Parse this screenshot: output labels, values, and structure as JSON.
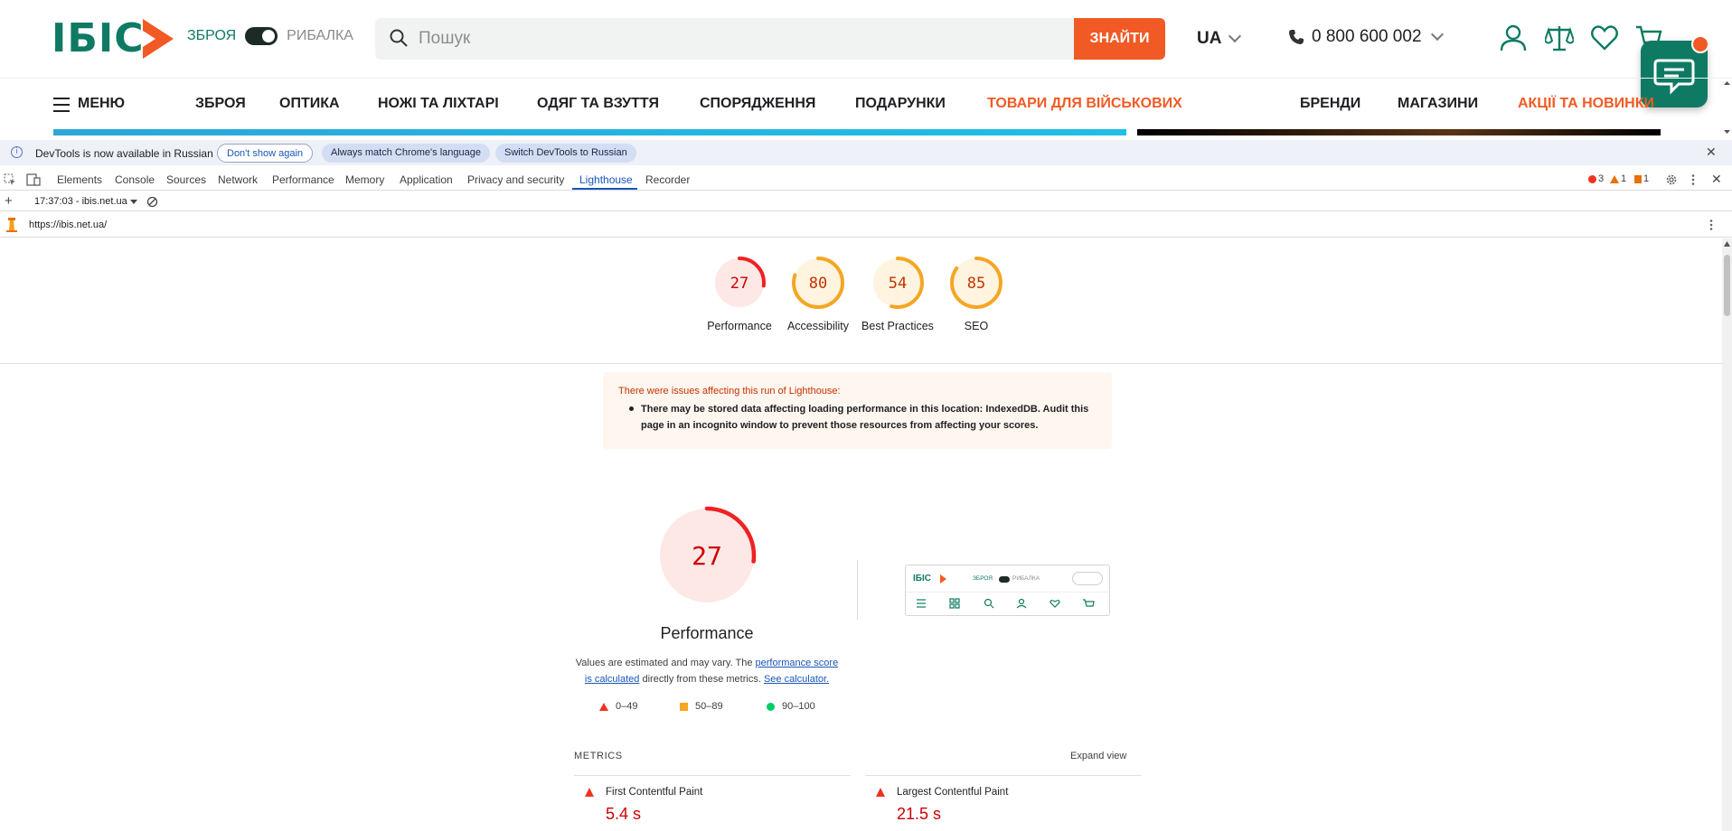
{
  "site": {
    "logo_text": "ІБІС",
    "mode_left": "ЗБРОЯ",
    "mode_right": "РИБАЛКА",
    "search": {
      "placeholder": "Пошук",
      "value": "",
      "button": "ЗНАЙТИ"
    },
    "lang": "UA",
    "phone": "0 800 600 002",
    "nav": {
      "menu": "МЕНЮ",
      "items": [
        "ЗБРОЯ",
        "ОПТИКА",
        "НОЖІ ТА ЛІХТАРІ",
        "ОДЯГ ТА ВЗУТТЯ",
        "СПОРЯДЖЕННЯ",
        "ПОДАРУНКИ",
        "ТОВАРИ ДЛЯ ВІЙСЬКОВИХ"
      ],
      "right": [
        "БРЕНДИ",
        "МАГАЗИНИ",
        "АКЦІЇ ТА НОВИНКИ"
      ]
    },
    "colors": {
      "brand": "#0f7a63",
      "accent": "#f15a24"
    }
  },
  "devtools": {
    "infobar": {
      "text": "DevTools is now available in Russian",
      "dont_show": "Don't show again",
      "match_lang": "Always match Chrome's language",
      "switch": "Switch DevTools to Russian"
    },
    "tabs": [
      "Elements",
      "Console",
      "Sources",
      "Network",
      "Performance",
      "Memory",
      "Application",
      "Privacy and security",
      "Lighthouse",
      "Recorder"
    ],
    "active_tab": "Lighthouse",
    "issues": {
      "errors": "3",
      "warnings": "1",
      "info": "1"
    },
    "report_select": "17:37:03 - ibis.net.ua",
    "url": "https://ibis.net.ua/"
  },
  "lighthouse": {
    "scores": [
      {
        "label": "Performance",
        "score": "27",
        "value": 27,
        "color": "#e22",
        "fill": "#fde8e6"
      },
      {
        "label": "Accessibility",
        "score": "80",
        "value": 80,
        "color": "#f5a623",
        "fill": "#fff4e0"
      },
      {
        "label": "Best Practices",
        "score": "54",
        "value": 54,
        "color": "#f5a623",
        "fill": "#fff4e0"
      },
      {
        "label": "SEO",
        "score": "85",
        "value": 85,
        "color": "#f5a623",
        "fill": "#fff4e0"
      }
    ],
    "warning_title": "There were issues affecting this run of Lighthouse:",
    "warning_item": "There may be stored data affecting loading performance in this location: IndexedDB. Audit this page in an incognito window to prevent those resources from affecting your scores.",
    "main_score": "27",
    "main_value": 27,
    "main_label": "Performance",
    "explain_prefix": "Values are estimated and may vary. The ",
    "explain_link1": "performance score is calculated",
    "explain_mid": " directly from these metrics. ",
    "explain_link2": "See calculator.",
    "legend": [
      "0–49",
      "50–89",
      "90–100"
    ],
    "thumbnail": {
      "logo": "ІБІС",
      "mode_left": "ЗБРОЯ",
      "mode_right": "РИБАЛКА"
    },
    "metrics_title": "METRICS",
    "expand_view": "Expand view",
    "metrics": [
      {
        "name": "First Contentful Paint",
        "value": "5.4 s"
      },
      {
        "name": "Largest Contentful Paint",
        "value": "21.5 s"
      }
    ]
  }
}
